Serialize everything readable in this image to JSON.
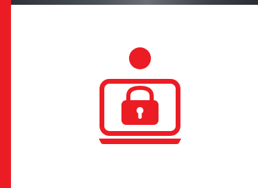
{
  "colors": {
    "accent": "#ec1c24",
    "background": "#ffffff",
    "photo_strip": "#3c4047"
  },
  "illustration": {
    "icon": "laptop-lock-icon",
    "parts": [
      "user-head-icon",
      "laptop-screen-icon",
      "padlock-icon",
      "laptop-base-icon"
    ]
  }
}
